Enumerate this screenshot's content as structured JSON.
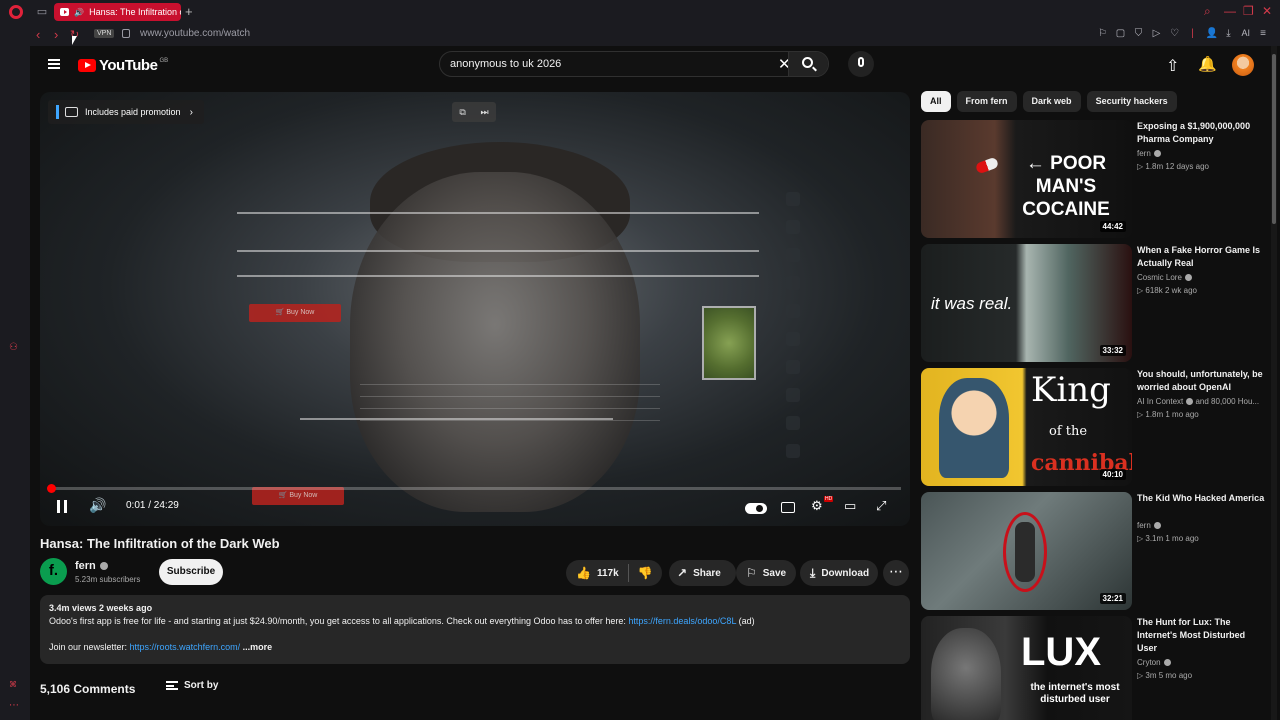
{
  "browser": {
    "tab_title": "Hansa: The Infiltration o",
    "new_tab": "+",
    "vpn_label": "VPN",
    "url": "www.youtube.com/watch",
    "ai_label": "AI"
  },
  "masthead": {
    "logo_text": "YouTube",
    "country_code": "GB",
    "search_value": "anonymous to uk 2026"
  },
  "player": {
    "promo": "Includes paid promotion",
    "time": "0:01 / 24:29",
    "progress_fraction": 0.0007,
    "screen_labels": {
      "buy_now": "🛒 Buy Now"
    }
  },
  "video": {
    "title": "Hansa: The Infiltration of the Dark Web",
    "channel": "fern",
    "channel_initial": "f.",
    "subscribers": "5.23m subscribers",
    "subscribe_label": "Subscribe",
    "likes": "117k",
    "share_label": "Share",
    "save_label": "Save",
    "download_label": "Download",
    "description": {
      "meta": "3.4m views  2 weeks ago",
      "line1": "Odoo's first app is free for life - and starting at just $24.90/month, you get access to all applications. Check out everything Odoo has to offer here: ",
      "link1": "https://fern.deals/odoo/C8L",
      "ad": " (ad)",
      "line2": "Join our newsletter: ",
      "link2": "https://roots.watchfern.com/",
      "more": "...more"
    },
    "comments_count": "5,106 Comments",
    "sort_label": "Sort by"
  },
  "chips": [
    "All",
    "From fern",
    "Dark web",
    "Security hackers"
  ],
  "recommendations": [
    {
      "title": "Exposing a $1,900,000,000 Pharma Company",
      "channel": "fern",
      "stats": "▷ 1.8m  12 days ago",
      "duration": "44:42",
      "thumb_text": "← POOR MAN'S COCAINE"
    },
    {
      "title": "When a Fake Horror Game Is Actually Real",
      "channel": "Cosmic Lore",
      "stats": "▷ 618k  2 wk ago",
      "duration": "33:32",
      "thumb_text": "it was real."
    },
    {
      "title": "You should, unfortunately, be worried about OpenAI",
      "channel": "AI In Context",
      "channel_extra": " and 80,000 Hou...",
      "stats": "▷ 1.8m  1 mo ago",
      "duration": "40:10",
      "thumb_text_1": "King",
      "thumb_text_2": "of the",
      "thumb_text_3": "cannibals"
    },
    {
      "title": "The Kid Who Hacked America",
      "channel": "fern",
      "stats": "▷ 3.1m  1 mo ago",
      "duration": "32:21"
    },
    {
      "title": "The Hunt for Lux: The Internet's Most Disturbed User",
      "channel": "Cryton",
      "stats": "▷ 3m  5 mo ago",
      "thumb_text_1": "LUX",
      "thumb_text_2": "the internet's most disturbed user"
    }
  ]
}
